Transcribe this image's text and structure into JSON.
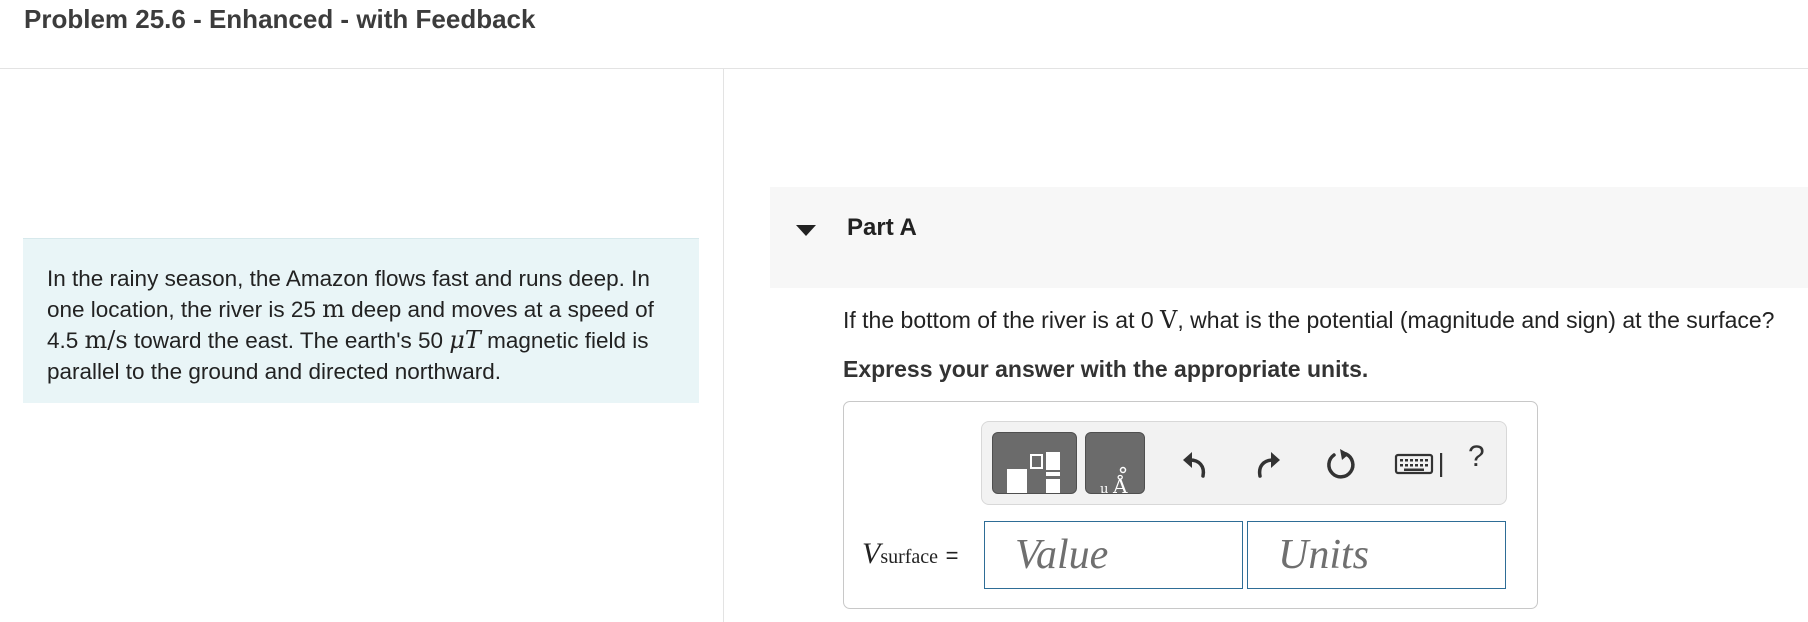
{
  "header": {
    "title": "Problem 25.6 - Enhanced - with Feedback"
  },
  "intro": {
    "t1": "In the rainy season, the Amazon flows fast and runs deep. In one location, the river is 25 ",
    "u1": "m",
    "t2": " deep and moves at a speed of 4.5 ",
    "u2": "m/s",
    "t3": " toward the east. The earth's 50 ",
    "u3": "μT",
    "t4": " magnetic field is parallel to the ground and directed northward."
  },
  "part": {
    "label": "Part A"
  },
  "question": {
    "t1": "If the bottom of the river is at 0 ",
    "u1": "V",
    "t2": ", what is the potential (magnitude and sign) at the surface?"
  },
  "instruction": "Express your answer with the appropriate units.",
  "toolbar": {
    "templates_icon": "fraction-template-icon",
    "units_icon": "units-template-icon",
    "undo_icon": "undo-icon",
    "redo_icon": "redo-icon",
    "reset_icon": "reset-icon",
    "keyboard_icon": "keyboard-icon",
    "help_label": "?"
  },
  "answer": {
    "var_symbol": "V",
    "var_subscript": "surface",
    "equals": "=",
    "value_placeholder": "Value",
    "units_placeholder": "Units"
  },
  "colors": {
    "intro_bg": "#e9f5f7",
    "input_border": "#2e6d96",
    "toolbar_btn": "#6b6b6b"
  }
}
